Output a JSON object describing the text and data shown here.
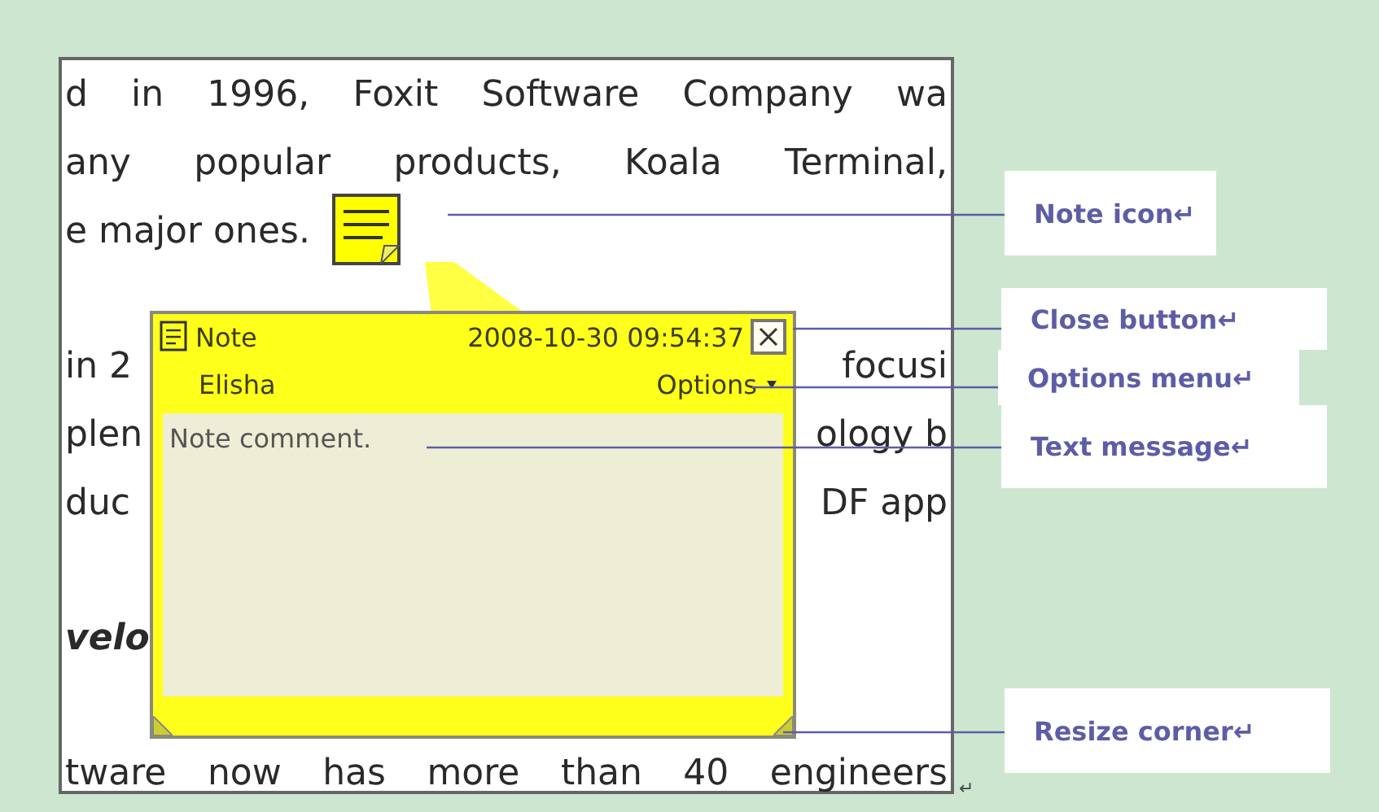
{
  "document": {
    "paragraphs": [
      {
        "lines": [
          {
            "kind": "full",
            "text": "d in 1996, Foxit Software Company wa"
          },
          {
            "kind": "full",
            "text": "any popular products, Koala Terminal,"
          },
          {
            "kind": "icon",
            "text": "e major ones."
          }
        ]
      },
      {
        "lines": [
          {
            "kind": "split",
            "left": "in 2",
            "right": "focusi"
          },
          {
            "kind": "split",
            "left": "plen",
            "right": "ology b"
          },
          {
            "kind": "split",
            "left": "duc",
            "right": "DF app"
          }
        ]
      },
      {
        "lines": [
          {
            "kind": "heading",
            "left": "velo"
          }
        ]
      },
      {
        "lines": [
          {
            "kind": "full",
            "text": "tware now has more than 40 engineers"
          }
        ]
      }
    ],
    "end_mark": "↵"
  },
  "note_popup": {
    "title": "Note",
    "timestamp": "2008-10-30 09:54:37",
    "author": "Elisha",
    "options": "Options",
    "comment": "Note comment."
  },
  "callouts": [
    {
      "label": "Note icon↵"
    },
    {
      "label": "Close button↵"
    },
    {
      "label": "Options menu↵"
    },
    {
      "label": "Text message↵"
    },
    {
      "label": "Resize corner↵"
    }
  ]
}
